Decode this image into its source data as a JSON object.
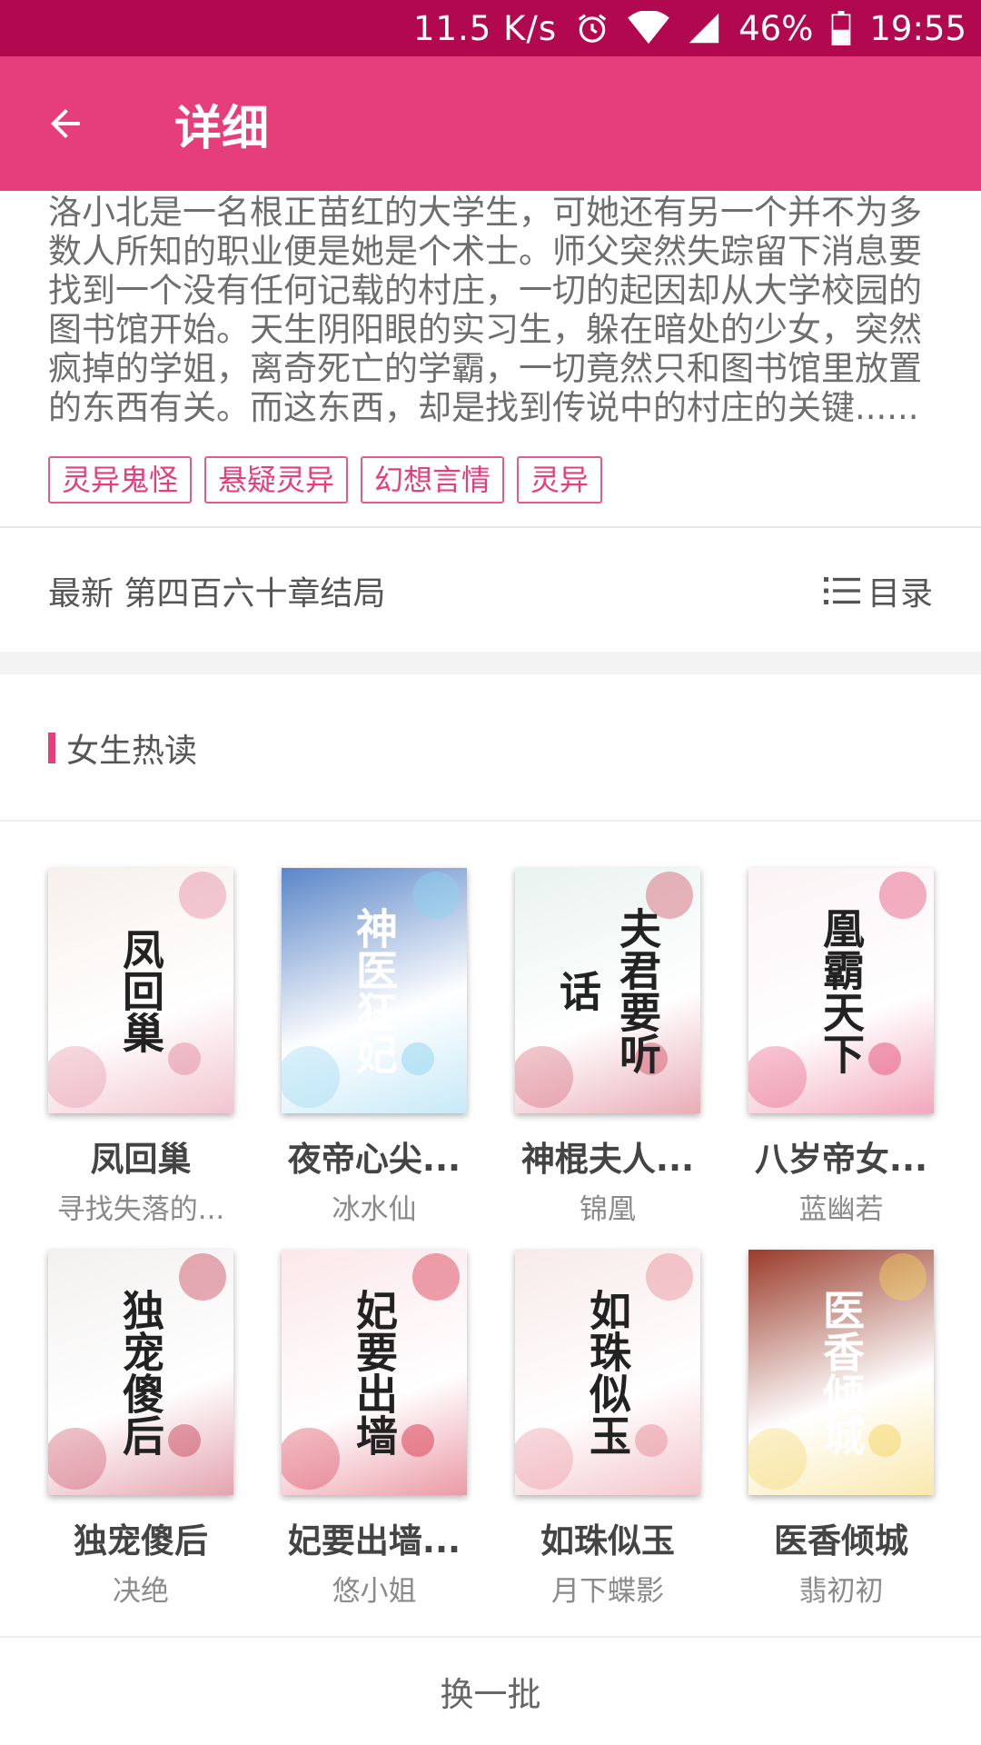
{
  "status_bar": {
    "net_speed": "11.5 K/s",
    "battery": "46%",
    "time": "19:55",
    "icons": [
      "alarm-icon",
      "wifi-icon",
      "signal-icon",
      "battery-icon"
    ]
  },
  "app_bar": {
    "title": "详细",
    "back_icon": "arrow-left-icon",
    "color": "#e63e7a"
  },
  "description": "洛小北是一名根正苗红的大学生，可她还有另一个并不为多数人所知的职业便是她是个术士。师父突然失踪留下消息要找到一个没有任何记载的村庄，一切的起因却从大学校园的图书馆开始。天生阴阳眼的实习生，躲在暗处的少女，突然疯掉的学姐，离奇死亡的学霸，一切竟然只和图书馆里放置的东西有关。而这东西，却是找到传说中的村庄的关键......",
  "tags": [
    "灵异鬼怪",
    "悬疑灵异",
    "幻想言情",
    "灵异"
  ],
  "latest": "最新 第四百六十章结局",
  "toc_label": "目录",
  "section_title": "女生热读",
  "books": [
    {
      "title": "凤回巢",
      "author": "寻找失落的...",
      "cover_text": "凤回巢",
      "bg": "#f7f0ec",
      "accent": "#e48aa0"
    },
    {
      "title": "夜帝心尖...",
      "author": "冰水仙",
      "cover_text": "神医狂妃",
      "bg": "#5a86c8",
      "accent": "#8fd4f0"
    },
    {
      "title": "神棍夫人...",
      "author": "锦凰",
      "cover_text": "夫君要听话",
      "bg": "#e9f3ef",
      "accent": "#d35a6e"
    },
    {
      "title": "八岁帝女...",
      "author": "蓝幽若",
      "cover_text": "凰霸天下",
      "bg": "#fbf3f5",
      "accent": "#e5507a"
    },
    {
      "title": "独宠傻后",
      "author": "决绝",
      "cover_text": "独宠傻后",
      "bg": "#f3f1f0",
      "accent": "#c9485e"
    },
    {
      "title": "妃要出墙...",
      "author": "悠小姐",
      "cover_text": "妃要出墙",
      "bg": "#fbe7ea",
      "accent": "#d8344b"
    },
    {
      "title": "如珠似玉",
      "author": "月下蝶影",
      "cover_text": "如珠似玉",
      "bg": "#f8eaea",
      "accent": "#e78b97"
    },
    {
      "title": "医香倾城",
      "author": "翡初初",
      "cover_text": "医香倾城",
      "bg": "#9a3b2a",
      "accent": "#f4d35e"
    }
  ],
  "more_label": "换一批"
}
